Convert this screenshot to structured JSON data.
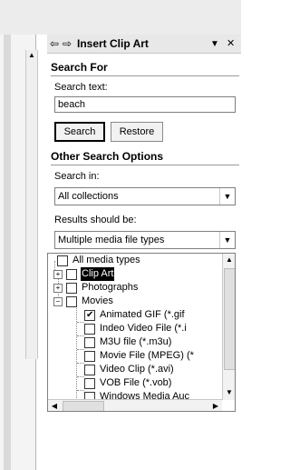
{
  "pane": {
    "title": "Insert Clip Art",
    "nav_back": "⇦",
    "nav_forward": "⇨",
    "menu_arrow": "▼",
    "close": "✕"
  },
  "search_for": {
    "heading": "Search For",
    "search_text_label": "Search text:",
    "search_text_value": "beach",
    "search_button": "Search",
    "restore_button": "Restore"
  },
  "other_options": {
    "heading": "Other Search Options",
    "search_in_label": "Search in:",
    "search_in_value": "All collections",
    "results_label": "Results should be:",
    "results_value": "Multiple media file types"
  },
  "tree": {
    "items": [
      {
        "label": "All media types",
        "checked": false
      },
      {
        "label": "Clip Art",
        "checked": false
      },
      {
        "label": "Photographs",
        "checked": false
      },
      {
        "label": "Movies",
        "checked": false
      },
      {
        "label": "Animated GIF (*.gif",
        "checked": true
      },
      {
        "label": "Indeo Video File (*.i",
        "checked": false
      },
      {
        "label": "M3U file (*.m3u)",
        "checked": false
      },
      {
        "label": "Movie File (MPEG) (*",
        "checked": false
      },
      {
        "label": "Video Clip (*.avi)",
        "checked": false
      },
      {
        "label": "VOB File (*.vob)",
        "checked": false
      },
      {
        "label": "Windows Media Auc",
        "checked": false
      }
    ]
  },
  "colors": {
    "header_bg": "#e8e8e8",
    "selection_bg": "#000000"
  }
}
